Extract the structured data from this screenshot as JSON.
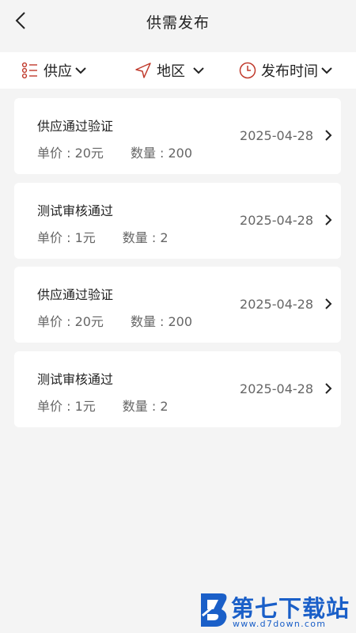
{
  "header": {
    "title": "供需发布",
    "back_icon": "chevron-left-icon"
  },
  "filters": [
    {
      "label": "供应",
      "icon": "list-icon"
    },
    {
      "label": "地区",
      "icon": "location-arrow-icon"
    },
    {
      "label": "发布时间",
      "icon": "clock-icon"
    }
  ],
  "items": [
    {
      "name": "供应通过验证",
      "price": "单价 : 20元",
      "qty": "数量 : 200",
      "date": "2025-04-28"
    },
    {
      "name": "测试审核通过",
      "price": "单价 : 1元",
      "qty": "数量 : 2",
      "date": "2025-04-28"
    },
    {
      "name": "供应通过验证",
      "price": "单价 : 20元",
      "qty": "数量 : 200",
      "date": "2025-04-28"
    },
    {
      "name": "测试审核通过",
      "price": "单价 : 1元",
      "qty": "数量 : 2",
      "date": "2025-04-28"
    }
  ],
  "watermark": {
    "text": "第七下载站",
    "url": "www.d7down.com"
  },
  "colors": {
    "accent_icon": "#c0392b",
    "watermark": "#1a5fc8",
    "background": "#f4f4f4"
  }
}
